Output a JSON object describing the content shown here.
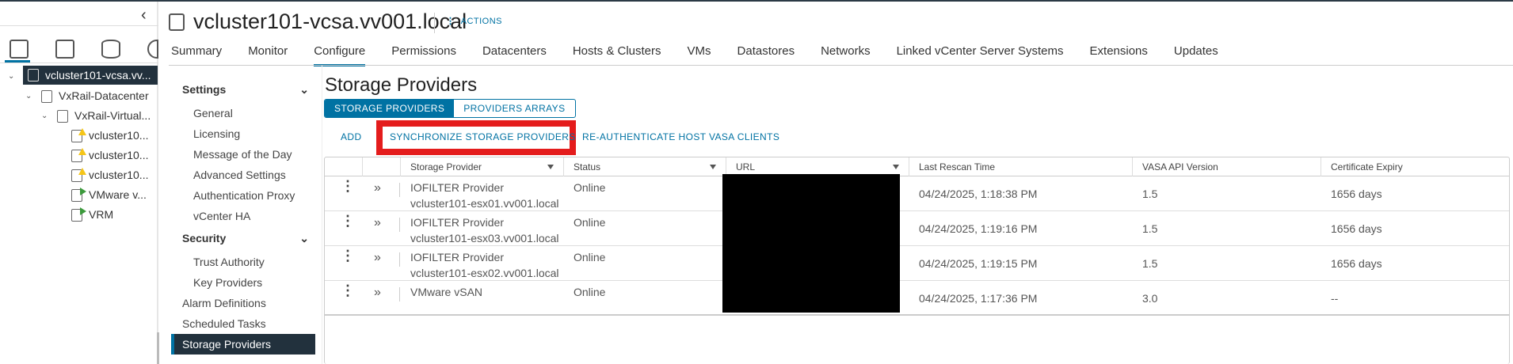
{
  "header": {
    "title": "vcluster101-vcsa.vv001.local",
    "actions_label": "ACTIONS"
  },
  "tabs": [
    "Summary",
    "Monitor",
    "Configure",
    "Permissions",
    "Datacenters",
    "Hosts & Clusters",
    "VMs",
    "Datastores",
    "Networks",
    "Linked vCenter Server Systems",
    "Extensions",
    "Updates"
  ],
  "active_tab": "Configure",
  "tree": {
    "selected": "vcluster101-vcsa.vv...",
    "items": [
      "VxRail-Datacenter",
      "VxRail-Virtual...",
      "vcluster10...",
      "vcluster10...",
      "vcluster10...",
      "VMware v...",
      "VRM"
    ]
  },
  "nav": {
    "settings_heading": "Settings",
    "settings": [
      "General",
      "Licensing",
      "Message of the Day",
      "Advanced Settings",
      "Authentication Proxy",
      "vCenter HA"
    ],
    "security_heading": "Security",
    "security": [
      "Trust Authority",
      "Key Providers"
    ],
    "other": [
      "Alarm Definitions",
      "Scheduled Tasks",
      "Storage Providers"
    ]
  },
  "content": {
    "title": "Storage Providers",
    "seg": [
      "STORAGE PROVIDERS",
      "PROVIDERS ARRAYS"
    ],
    "actions": [
      "ADD",
      "SYNCHRONIZE STORAGE PROVIDERS",
      "RE-AUTHENTICATE HOST VASA CLIENTS"
    ]
  },
  "table": {
    "columns": [
      "Storage Provider",
      "Status",
      "URL",
      "Last Rescan Time",
      "VASA API Version",
      "Certificate Expiry"
    ],
    "rows": [
      {
        "provider": "IOFILTER Provider vcluster101-esx01.vv001.local",
        "status": "Online",
        "rescan": "04/24/2025, 1:18:38 PM",
        "vasa": "1.5",
        "expiry": "1656 days"
      },
      {
        "provider": "IOFILTER Provider vcluster101-esx03.vv001.local",
        "status": "Online",
        "rescan": "04/24/2025, 1:19:16 PM",
        "vasa": "1.5",
        "expiry": "1656 days"
      },
      {
        "provider": "IOFILTER Provider vcluster101-esx02.vv001.local",
        "status": "Online",
        "rescan": "04/24/2025, 1:19:15 PM",
        "vasa": "1.5",
        "expiry": "1656 days"
      },
      {
        "provider": "VMware vSAN",
        "status": "Online",
        "rescan": "04/24/2025, 1:17:36 PM",
        "vasa": "3.0",
        "expiry": "--"
      }
    ]
  },
  "colors": {
    "accent": "#0072a3",
    "highlight": "#e41c1c",
    "selected_bg": "#22313d"
  }
}
